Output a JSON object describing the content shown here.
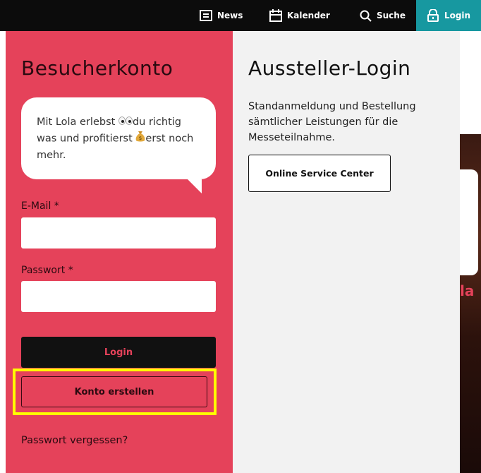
{
  "nav": {
    "news": "News",
    "calendar": "Kalender",
    "search": "Suche",
    "login": "Login"
  },
  "visitor": {
    "title": "Besucherkonto",
    "bubble_part1": "Mit Lola erlebst ",
    "bubble_part2": "du richtig was und profitierst ",
    "bubble_part3": "erst noch mehr.",
    "email_label": "E-Mail *",
    "email_value": "",
    "password_label": "Passwort *",
    "password_value": "",
    "login_button": "Login",
    "create_account_button": "Konto erstellen",
    "forgot_password": "Passwort vergessen?"
  },
  "exhibitor": {
    "title": "Aussteller-Login",
    "description": "Standanmeldung und Bestellung sämtlicher Leistungen für die Messeteilnahme.",
    "service_button": "Online Service Center"
  },
  "hero": {
    "lola_fragment": "la"
  },
  "colors": {
    "accent_red": "#e5425a",
    "teal": "#1798a0",
    "highlight": "#ffff00"
  }
}
